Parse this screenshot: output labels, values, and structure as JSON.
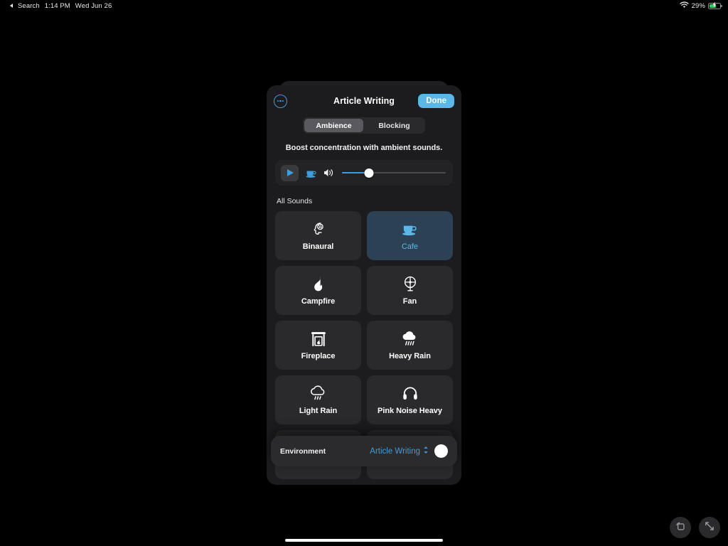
{
  "statusbar": {
    "back_label": "Search",
    "time": "1:14 PM",
    "date": "Wed Jun 26",
    "battery_percent": "29%",
    "wifi_icon": "wifi-icon",
    "battery_icon": "battery-charging-icon",
    "battery_color": "#34c759"
  },
  "panel": {
    "title": "Article Writing",
    "more_icon": "ellipsis-circle-icon",
    "done_label": "Done",
    "accent_color": "#5ab7e8",
    "tabs": [
      {
        "label": "Ambience",
        "selected": true
      },
      {
        "label": "Blocking",
        "selected": false
      }
    ],
    "subtitle": "Boost concentration with ambient sounds.",
    "player": {
      "play_icon": "play-icon",
      "track_icon": "cafe-cup-icon",
      "volume_icon": "speaker-wave-icon",
      "volume_percent": 26
    },
    "section_title": "All Sounds",
    "sounds": [
      {
        "label": "Binaural",
        "icon": "head-brain-icon",
        "selected": false
      },
      {
        "label": "Cafe",
        "icon": "cafe-cup-icon",
        "selected": true
      },
      {
        "label": "Campfire",
        "icon": "flame-icon",
        "selected": false
      },
      {
        "label": "Fan",
        "icon": "fan-icon",
        "selected": false
      },
      {
        "label": "Fireplace",
        "icon": "fireplace-icon",
        "selected": false
      },
      {
        "label": "Heavy Rain",
        "icon": "heavy-rain-icon",
        "selected": false
      },
      {
        "label": "Light Rain",
        "icon": "light-rain-icon",
        "selected": false
      },
      {
        "label": "Pink Noise Heavy",
        "icon": "headphones-icon",
        "selected": false
      }
    ]
  },
  "environment_bar": {
    "label": "Environment",
    "value": "Article Writing",
    "chevron_icon": "up-down-chevron-icon",
    "action_icon": "record-circle-icon"
  },
  "floating_buttons": [
    {
      "icon": "picture-in-picture-icon"
    },
    {
      "icon": "expand-arrows-icon"
    }
  ]
}
